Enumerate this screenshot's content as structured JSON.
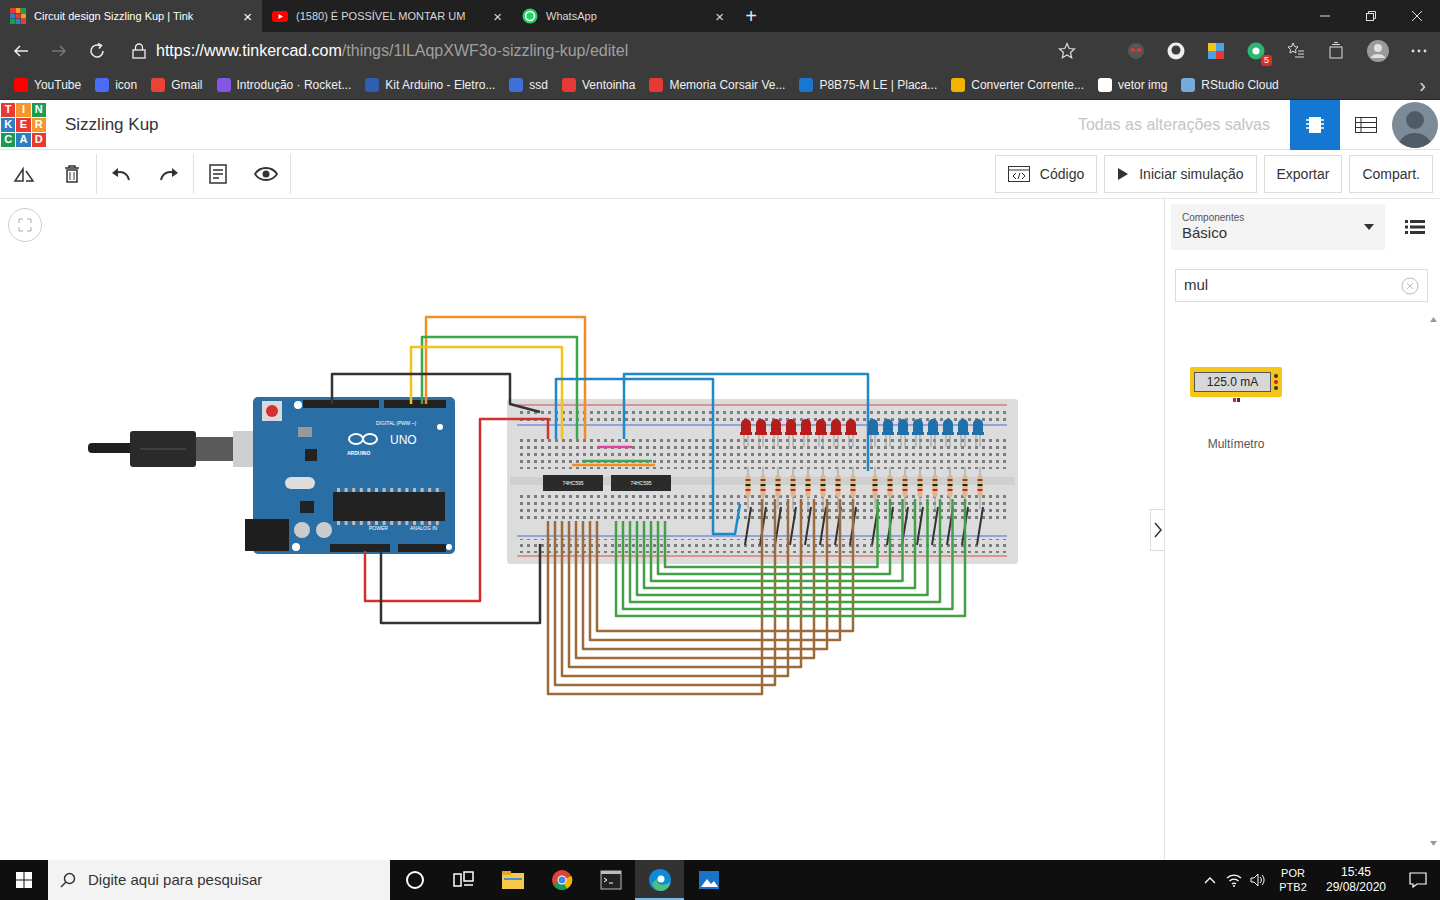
{
  "browser": {
    "tabs": [
      {
        "label": "Circuit design Sizzling Kup | Tink",
        "close": "×",
        "selected": true
      },
      {
        "label": "(1580) É POSSÍVEL MONTAR UM",
        "close": "×",
        "selected": false
      },
      {
        "label": "WhatsApp",
        "close": "×",
        "selected": false
      }
    ],
    "new_tab": "+",
    "url": {
      "host": "https://www.tinkercad.com",
      "path": "/things/1lLAqpXWF3o-sizzling-kup/editel"
    },
    "extension_badge": "5",
    "bookmarks": [
      {
        "label": "YouTube",
        "color": "#ff0000"
      },
      {
        "label": "icon",
        "color": "#4a6cf7"
      },
      {
        "label": "Gmail",
        "color": "#ea4335"
      },
      {
        "label": "Introdução · Rocket...",
        "color": "#8257e5"
      },
      {
        "label": "Kit Arduino - Eletro...",
        "color": "#2f5fb3"
      },
      {
        "label": "ssd",
        "color": "#3f6fd8"
      },
      {
        "label": "Ventoinha",
        "color": "#e53935"
      },
      {
        "label": "Memoria Corsair Ve...",
        "color": "#e53935"
      },
      {
        "label": "P8B75-M LE | Placa...",
        "color": "#1976d2"
      },
      {
        "label": "Converter Corrente...",
        "color": "#f2b400"
      },
      {
        "label": "vetor img",
        "color": "#ffffff"
      },
      {
        "label": "RStudio Cloud",
        "color": "#75aadb"
      }
    ],
    "bookmarks_more": "›"
  },
  "app": {
    "logo": [
      "T",
      "I",
      "N",
      "K",
      "E",
      "R",
      "C",
      "A",
      "D"
    ],
    "title": "Sizzling Kup",
    "save_status": "Todas as alterações salvas"
  },
  "toolbar": {
    "buttons": [
      {
        "label": "Código",
        "kind": "code"
      },
      {
        "label": "Iniciar simulação",
        "kind": "play"
      },
      {
        "label": "Exportar",
        "kind": "plain"
      },
      {
        "label": "Compart.",
        "kind": "plain"
      }
    ]
  },
  "panel": {
    "dropdown": {
      "caption": "Componentes",
      "value": "Básico"
    },
    "search": {
      "value": "mul"
    },
    "components": [
      {
        "name": "Multímetro",
        "reading": "125.0 mA"
      }
    ]
  },
  "circuit": {
    "arduino": {
      "model": "UNO",
      "brand": "ARDUINO",
      "digital_label": "DIGITAL (PWM ~)",
      "power_label": "POWER",
      "analog_label": "ANALOG IN"
    },
    "chips": [
      {
        "label": "74HC595"
      },
      {
        "label": "74HC595"
      }
    ],
    "leds": [
      {
        "color": "#b71c1c"
      },
      {
        "color": "#b71c1c"
      },
      {
        "color": "#b71c1c"
      },
      {
        "color": "#b71c1c"
      },
      {
        "color": "#b71c1c"
      },
      {
        "color": "#b71c1c"
      },
      {
        "color": "#b71c1c"
      },
      {
        "color": "#b71c1c"
      },
      {
        "color": "#1f6fa8"
      },
      {
        "color": "#1f6fa8"
      },
      {
        "color": "#1f6fa8"
      },
      {
        "color": "#1f6fa8"
      },
      {
        "color": "#1f6fa8"
      },
      {
        "color": "#1f6fa8"
      },
      {
        "color": "#1f6fa8"
      },
      {
        "color": "#1f6fa8"
      }
    ],
    "wires": [
      {
        "color": "#f28c28"
      },
      {
        "color": "#3aa84a"
      },
      {
        "color": "#f2c318"
      },
      {
        "color": "#333333"
      },
      {
        "color": "#d32f2f"
      },
      {
        "color": "#333333"
      },
      {
        "color": "#1e88c8"
      },
      {
        "color": "#1e88c8"
      },
      {
        "color": "#3aa84a"
      },
      {
        "color": "#e040a0"
      },
      {
        "color": "#f28c28"
      },
      {
        "color": "#9c6b3c"
      },
      {
        "color": "#9c6b3c"
      },
      {
        "color": "#9c6b3c"
      },
      {
        "color": "#9c6b3c"
      },
      {
        "color": "#9c6b3c"
      },
      {
        "color": "#9c6b3c"
      },
      {
        "color": "#9c6b3c"
      },
      {
        "color": "#9c6b3c"
      },
      {
        "color": "#43a047"
      },
      {
        "color": "#43a047"
      },
      {
        "color": "#43a047"
      },
      {
        "color": "#43a047"
      },
      {
        "color": "#43a047"
      },
      {
        "color": "#43a047"
      },
      {
        "color": "#43a047"
      },
      {
        "color": "#43a047"
      }
    ]
  },
  "taskbar": {
    "search_placeholder": "Digite aqui para pesquisar",
    "apps": [
      {
        "kind": "cortana",
        "selected": false
      },
      {
        "kind": "taskview",
        "selected": false
      },
      {
        "kind": "explorer",
        "selected": false
      },
      {
        "kind": "chrome",
        "selected": false
      },
      {
        "kind": "terminal",
        "selected": false
      },
      {
        "kind": "edge",
        "selected": true
      },
      {
        "kind": "photos",
        "selected": false
      }
    ],
    "language": "POR",
    "layout": "PTB2",
    "time": "15:45",
    "date": "29/08/2020"
  }
}
